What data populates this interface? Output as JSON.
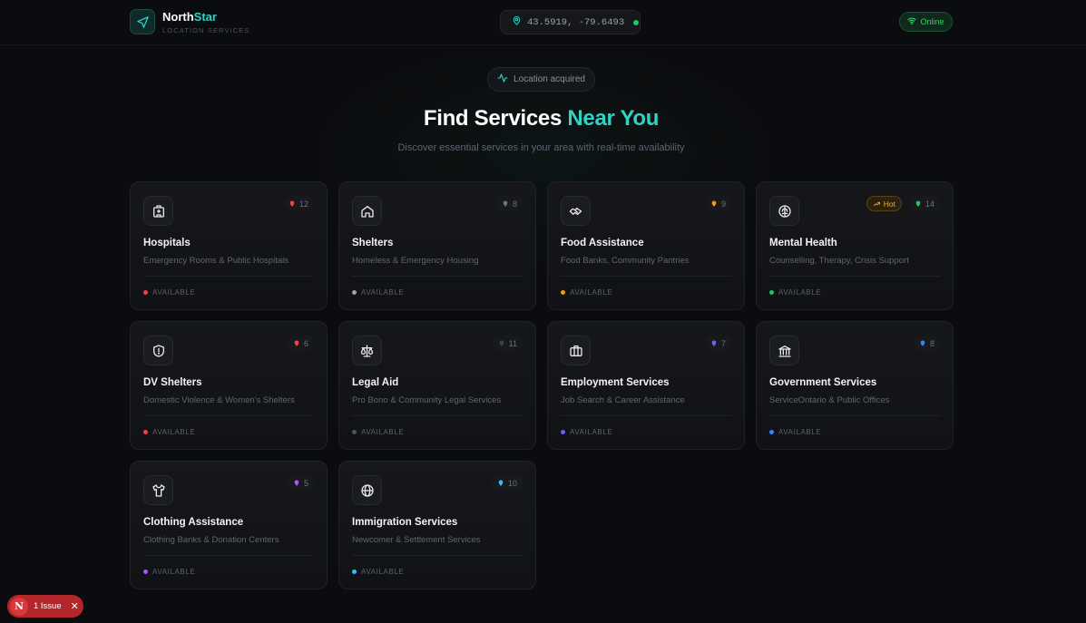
{
  "header": {
    "brand_name_main": "North",
    "brand_name_accent": "Star",
    "brand_sub": "LOCATION SERVICES",
    "coords": "43.5919, -79.6493",
    "status": "Online"
  },
  "hero": {
    "pill": "Location acquired",
    "title_main": "Find Services",
    "title_accent": "Near You",
    "subtitle": "Discover essential services in your area with real-time availability"
  },
  "cards": [
    {
      "icon": "hospital-icon",
      "name": "Hospitals",
      "desc": "Emergency Rooms & Public Hospitals",
      "count": "12",
      "status": "AVAILABLE",
      "color": "#ef4444"
    },
    {
      "icon": "home-icon",
      "name": "Shelters",
      "desc": "Homeless & Emergency Housing",
      "count": "8",
      "status": "AVAILABLE",
      "color": "#9ca3af"
    },
    {
      "icon": "handshake-icon",
      "name": "Food Assistance",
      "desc": "Food Banks, Community Pantries",
      "count": "9",
      "status": "AVAILABLE",
      "color": "#f59e0b"
    },
    {
      "icon": "brain-icon",
      "name": "Mental Health",
      "desc": "Counselling, Therapy, Crisis Support",
      "count": "14",
      "status": "AVAILABLE",
      "color": "#22c55e",
      "badge": "Hot"
    },
    {
      "icon": "shield-icon",
      "name": "DV Shelters",
      "desc": "Domestic Violence & Women's Shelters",
      "count": "6",
      "status": "AVAILABLE",
      "color": "#ef4444"
    },
    {
      "icon": "scale-icon",
      "name": "Legal Aid",
      "desc": "Pro Bono & Community Legal Services",
      "count": "11",
      "status": "AVAILABLE",
      "color": "#4b5563"
    },
    {
      "icon": "briefcase-icon",
      "name": "Employment Services",
      "desc": "Job Search & Career Assistance",
      "count": "7",
      "status": "AVAILABLE",
      "color": "#6366f1"
    },
    {
      "icon": "bank-icon",
      "name": "Government Services",
      "desc": "ServiceOntario & Public Offices",
      "count": "8",
      "status": "AVAILABLE",
      "color": "#3b82f6"
    },
    {
      "icon": "shirt-icon",
      "name": "Clothing Assistance",
      "desc": "Clothing Banks & Donation Centers",
      "count": "5",
      "status": "AVAILABLE",
      "color": "#a855f7"
    },
    {
      "icon": "globe-icon",
      "name": "Immigration Services",
      "desc": "Newcomer & Settlement Services",
      "count": "10",
      "status": "AVAILABLE",
      "color": "#38bdf8"
    }
  ],
  "dev_overlay": {
    "badge": "N",
    "label": "1 Issue"
  }
}
